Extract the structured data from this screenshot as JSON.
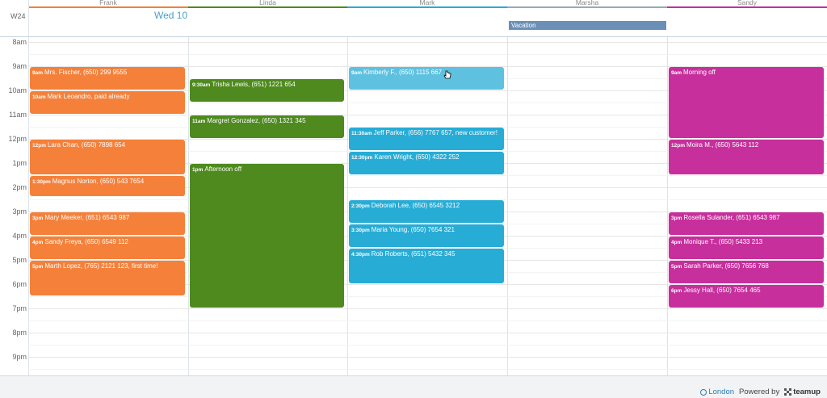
{
  "colors": {
    "frank": "#f5803a",
    "linda": "#4e8a1e",
    "mark": "#27acd6",
    "mark_light": "#5ec1e0",
    "marsha": "#9aa7b5",
    "sandy": "#c72f9c",
    "vacation": "#6b8fb6"
  },
  "people": [
    "Frank",
    "Linda",
    "Mark",
    "Marsha",
    "Sandy"
  ],
  "week_label": "W24",
  "date_label": "Wed 10",
  "allday": {
    "vacation": "Vacation"
  },
  "hours": [
    "8am",
    "9am",
    "10am",
    "11am",
    "12pm",
    "1pm",
    "2pm",
    "3pm",
    "4pm",
    "5pm",
    "6pm",
    "7pm",
    "8pm",
    "9pm"
  ],
  "events": {
    "frank": [
      {
        "time": "9am",
        "title": "Mrs. Fischer, (650) 299 9555"
      },
      {
        "time": "10am",
        "title": "Mark Leoandro, paid already"
      },
      {
        "time": "12pm",
        "title": "Lara Chan, (650) 7898 654"
      },
      {
        "time": "1:30pm",
        "title": "Magnus Norton, (650) 543 7654"
      },
      {
        "time": "3pm",
        "title": "Mary Meeker, (651) 6543 987"
      },
      {
        "time": "4pm",
        "title": "Sandy Freya, (650) 6549 112"
      },
      {
        "time": "5pm",
        "title": "Marth Lopez, (765) 2121 123, first time!"
      }
    ],
    "linda": [
      {
        "time": "9:30am",
        "title": "Trisha Lewis, (651) 1221 654"
      },
      {
        "time": "11am",
        "title": "Margret Gonzalez, (650) 1321 345"
      },
      {
        "time": "1pm",
        "title": "Afternoon off"
      }
    ],
    "mark": [
      {
        "time": "9am",
        "title": "Kimberly F., (650) 1115 667"
      },
      {
        "time": "11:30am",
        "title": "Jeff Parker, (656) 7767 657, new customer!"
      },
      {
        "time": "12:30pm",
        "title": "Karen Wright, (650) 4322 252"
      },
      {
        "time": "2:30pm",
        "title": "Deborah Lee, (650) 6545 3212"
      },
      {
        "time": "3:30pm",
        "title": "Maria Young, (650) 7654 321"
      },
      {
        "time": "4:30pm",
        "title": "Rob Roberts, (651) 5432 345"
      }
    ],
    "sandy": [
      {
        "time": "9am",
        "title": "Morning off"
      },
      {
        "time": "12pm",
        "title": "Moira M., (650) 5643 112"
      },
      {
        "time": "3pm",
        "title": "Rosella Sulander, (651) 6543 987"
      },
      {
        "time": "4pm",
        "title": "Monique T., (650) 5433 213"
      },
      {
        "time": "5pm",
        "title": "Sarah Parker, (650) 7656 768"
      },
      {
        "time": "6pm",
        "title": "Jessy Hall, (650) 7654 465"
      }
    ]
  },
  "footer": {
    "timezone": "London",
    "powered_by": "Powered by",
    "brand": "teamup"
  }
}
